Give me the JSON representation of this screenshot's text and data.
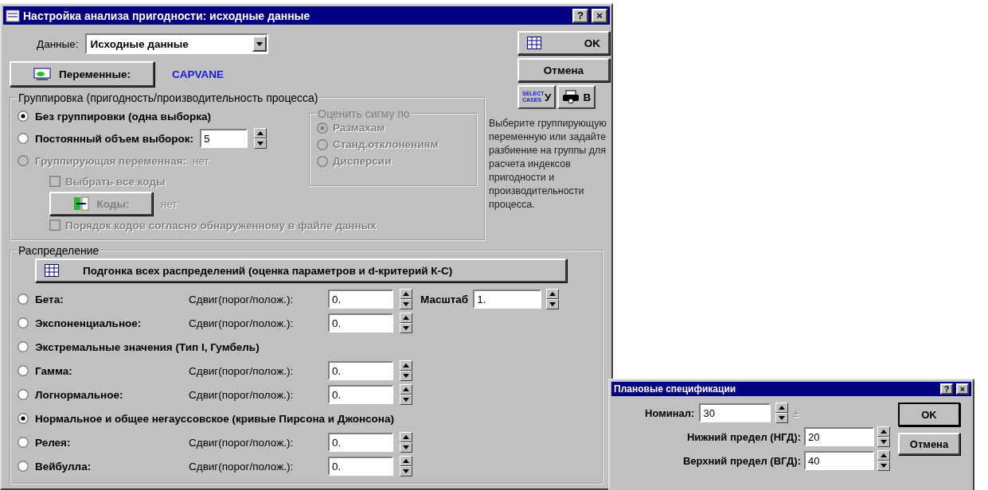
{
  "main_window": {
    "title": "Настройка анализа пригодности: исходные данные",
    "title_buttons": [
      "?",
      "×"
    ],
    "data_label": "Данные:",
    "data_value": "Исходные данные",
    "variables_button": "Переменные:",
    "variables_value": "CAPVANE",
    "ok_button": "OK",
    "cancel_button": "Отмена",
    "select_cases_text": "SELECT CASES",
    "select_button": "У",
    "print_button": "В",
    "grouping": {
      "legend": "Группировка (пригодность/производительность процесса)",
      "options": [
        {
          "kind": "plain",
          "label": "Без группировки (одна выборка)",
          "selected": true,
          "disabled": false
        },
        {
          "kind": "spin",
          "label": "Постоянный объем выборок:",
          "value": "5",
          "selected": false,
          "disabled": false
        },
        {
          "kind": "variable",
          "label": "Группирующая переменная:",
          "value": "нет",
          "selected": false,
          "disabled": true
        }
      ],
      "select_all": {
        "label": "Выбрать все коды",
        "checked": false,
        "disabled": true
      },
      "codes": {
        "label": "Коды:",
        "value": "нет",
        "disabled": true
      },
      "order": {
        "label": "Порядок кодов согласно обнаруженному в файле данных",
        "checked": false,
        "disabled": true
      },
      "sigma": {
        "legend": "Оценить сигму по",
        "disabled": true,
        "options": [
          {
            "label": "Размахам",
            "selected": true
          },
          {
            "label": "Станд.отклонениям",
            "selected": false
          },
          {
            "label": "Дисперсии",
            "selected": false
          }
        ]
      }
    },
    "hint": "Выберите группирующую переменную или задайте разбиение на группы для расчета индексов пригодности и производительности процесса.",
    "distribution": {
      "legend": "Распределение",
      "fit_button": "Подгонка всех распределений (оценка параметров и d-критерий К-С)",
      "options": [
        {
          "kind": "shift_scale",
          "label": "Бета:",
          "selected": false,
          "shift_label": "Сдвиг(порог/полож.):",
          "shift_value": "0.",
          "scale_label": "Масштаб",
          "scale_value": "1."
        },
        {
          "kind": "shift",
          "label": "Экспоненциальное:",
          "selected": false,
          "shift_label": "Сдвиг(порог/полож.):",
          "shift_value": "0."
        },
        {
          "kind": "plain",
          "label": "Экстремальные значения (Тип I, Гумбель)",
          "selected": false
        },
        {
          "kind": "shift",
          "label": "Гамма:",
          "selected": false,
          "shift_label": "Сдвиг(порог/полож.):",
          "shift_value": "0."
        },
        {
          "kind": "shift",
          "label": "Логнормальное:",
          "selected": false,
          "shift_label": "Сдвиг(порог/полож.):",
          "shift_value": "0."
        },
        {
          "kind": "plain",
          "label": "Нормальное и общее негауссовское (кривые Пирсона и Джонсона)",
          "selected": true
        },
        {
          "kind": "shift",
          "label": "Релея:",
          "selected": false,
          "shift_label": "Сдвиг(порог/полож.):",
          "shift_value": "0."
        },
        {
          "kind": "shift",
          "label": "Вейбулла:",
          "selected": false,
          "shift_label": "Сдвиг(порог/полож.):",
          "shift_value": "0."
        }
      ]
    }
  },
  "spec_window": {
    "title": "Плановые спецификации",
    "title_buttons": [
      "?",
      "×"
    ],
    "nominal_label": "Номинал:",
    "nominal_value": "30",
    "plus_minus": "±",
    "lower_label": "Нижний предел (НГД):",
    "lower_value": "20",
    "upper_label": "Верхний предел (ВГД):",
    "upper_value": "40",
    "ok_button": "OK",
    "cancel_button": "Отмена"
  }
}
